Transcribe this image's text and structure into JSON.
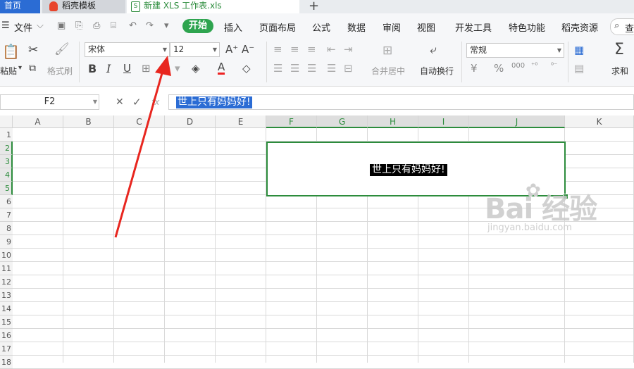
{
  "tabs": {
    "home": "首页",
    "template": "稻壳模板",
    "file": "新建 XLS 工作表.xls",
    "file_icon": "S",
    "new_tab": "+"
  },
  "menu": {
    "file": "文件",
    "start": "开始",
    "insert": "插入",
    "page_layout": "页面布局",
    "formula": "公式",
    "data": "数据",
    "review": "审阅",
    "view": "视图",
    "developer": "开发工具",
    "special": "特色功能",
    "docer": "稻壳资源",
    "search": "查"
  },
  "ribbon": {
    "paste": "粘贴",
    "format_painter": "格式刷",
    "font_name": "宋体",
    "font_size": "12",
    "bold": "B",
    "italic": "I",
    "underline": "U",
    "font_color_letter": "A",
    "grow_font": "A⁺",
    "shrink_font": "A⁻",
    "merge_center": "合并居中",
    "wrap_text": "自动换行",
    "number_format": "常规",
    "currency": "¥",
    "percent": "%",
    "thousands": "000",
    "sum": "求和",
    "sum_symbol": "Σ"
  },
  "formula_bar": {
    "name_box": "F2",
    "cancel": "✕",
    "confirm": "✓",
    "fx": "fx",
    "content": "世上只有妈妈好!"
  },
  "sheet": {
    "columns": [
      "A",
      "B",
      "C",
      "D",
      "E",
      "F",
      "G",
      "H",
      "I",
      "J",
      "K"
    ],
    "selected_columns": [
      "F",
      "G",
      "H",
      "I",
      "J"
    ],
    "rows": [
      "1",
      "2",
      "3",
      "4",
      "5",
      "6",
      "7",
      "8",
      "9",
      "10",
      "11",
      "12",
      "13",
      "14",
      "15",
      "16",
      "17",
      "18"
    ],
    "selected_rows": [
      "2",
      "3",
      "4",
      "5"
    ],
    "merged_cell_text": "世上只有妈妈好!"
  },
  "watermark": {
    "brand": "Bai 经验",
    "url": "jingyan.baidu.com"
  },
  "colors": {
    "accent_green": "#2c8c3c",
    "tab_blue": "#2b6cd4",
    "annotation_red": "#e8261f"
  }
}
